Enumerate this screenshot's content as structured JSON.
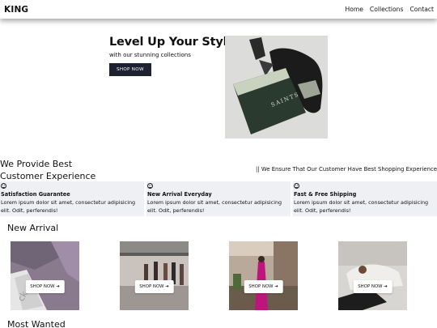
{
  "nav": {
    "brand": "KING",
    "links": [
      "Home",
      "Collections",
      "Contact"
    ]
  },
  "hero": {
    "title": "Level Up Your Style",
    "subtitle": "with our stunning collections",
    "button": "SHOP NOW",
    "image_alt": "SAINTS"
  },
  "experience": {
    "title_line1": "We Provide Best",
    "title_line2": "Customer Experience",
    "tagline": "|| We Ensure That Our Customer Have Best Shopping Experience",
    "features": [
      {
        "icon": "smile-icon",
        "title": "Satisfaction Guarantee",
        "text": "Lorem ipsum dolor sit amet, consectetur adipisicing elit. Odit, perferendis!"
      },
      {
        "icon": "smile-icon",
        "title": "New Arrival Everyday",
        "text": "Lorem ipsum dolor sit amet, consectetur adipisicing elit. Odit, perferendis!"
      },
      {
        "icon": "smile-icon",
        "title": "Fast & Free Shipping",
        "text": "Lorem ipsum dolor sit amet, consectetur adipisicing elit. Odit, perferendis!"
      }
    ]
  },
  "new_arrival": {
    "title": "New Arrival",
    "items": [
      {
        "button": "SHOP NOW",
        "arrow": "➔"
      },
      {
        "button": "SHOP NOW",
        "arrow": "➔"
      },
      {
        "button": "SHOP NOW",
        "arrow": "➔"
      },
      {
        "button": "SHOP NOW",
        "arrow": "➔"
      }
    ]
  },
  "most_wanted": {
    "title": "Most Wanted"
  }
}
